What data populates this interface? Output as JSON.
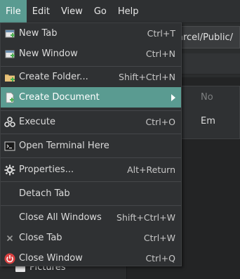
{
  "menubar": {
    "items": [
      {
        "label": "File",
        "active": true
      },
      {
        "label": "Edit",
        "active": false
      },
      {
        "label": "View",
        "active": false
      },
      {
        "label": "Go",
        "active": false
      },
      {
        "label": "Help",
        "active": false
      }
    ]
  },
  "background": {
    "path_text": "arcel/Public/",
    "sidebar_item": "Pictures"
  },
  "file_menu": {
    "items": [
      {
        "label": "New Tab",
        "shortcut": "Ctrl+T",
        "icon": "new-tab-icon"
      },
      {
        "label": "New Window",
        "shortcut": "Ctrl+N",
        "icon": "new-window-icon"
      },
      {
        "label": "Create Folder...",
        "shortcut": "Shift+Ctrl+N",
        "icon": "create-folder-icon"
      },
      {
        "label": "Create Document",
        "shortcut": "",
        "icon": "create-document-icon",
        "submenu": true,
        "highlighted": true
      },
      {
        "label": "Execute",
        "shortcut": "Ctrl+O",
        "icon": "execute-icon"
      },
      {
        "label": "Open Terminal Here",
        "shortcut": "",
        "icon": "terminal-icon"
      },
      {
        "label": "Properties...",
        "shortcut": "Alt+Return",
        "icon": "gear-icon"
      },
      {
        "label": "Detach Tab",
        "shortcut": "",
        "icon": ""
      },
      {
        "label": "Close All Windows",
        "shortcut": "Shift+Ctrl+W",
        "icon": ""
      },
      {
        "label": "Close Tab",
        "shortcut": "Ctrl+W",
        "icon": "close-icon"
      },
      {
        "label": "Close Window",
        "shortcut": "Ctrl+Q",
        "icon": "power-icon"
      }
    ]
  },
  "create_document_submenu": {
    "items": [
      {
        "label": "No",
        "enabled": false
      },
      {
        "label": "Em",
        "enabled": true
      }
    ]
  },
  "colors": {
    "accent": "#5a9b91",
    "menu_bg": "#2f3133",
    "power_red": "#d94040",
    "icon_green": "#4caf50"
  }
}
